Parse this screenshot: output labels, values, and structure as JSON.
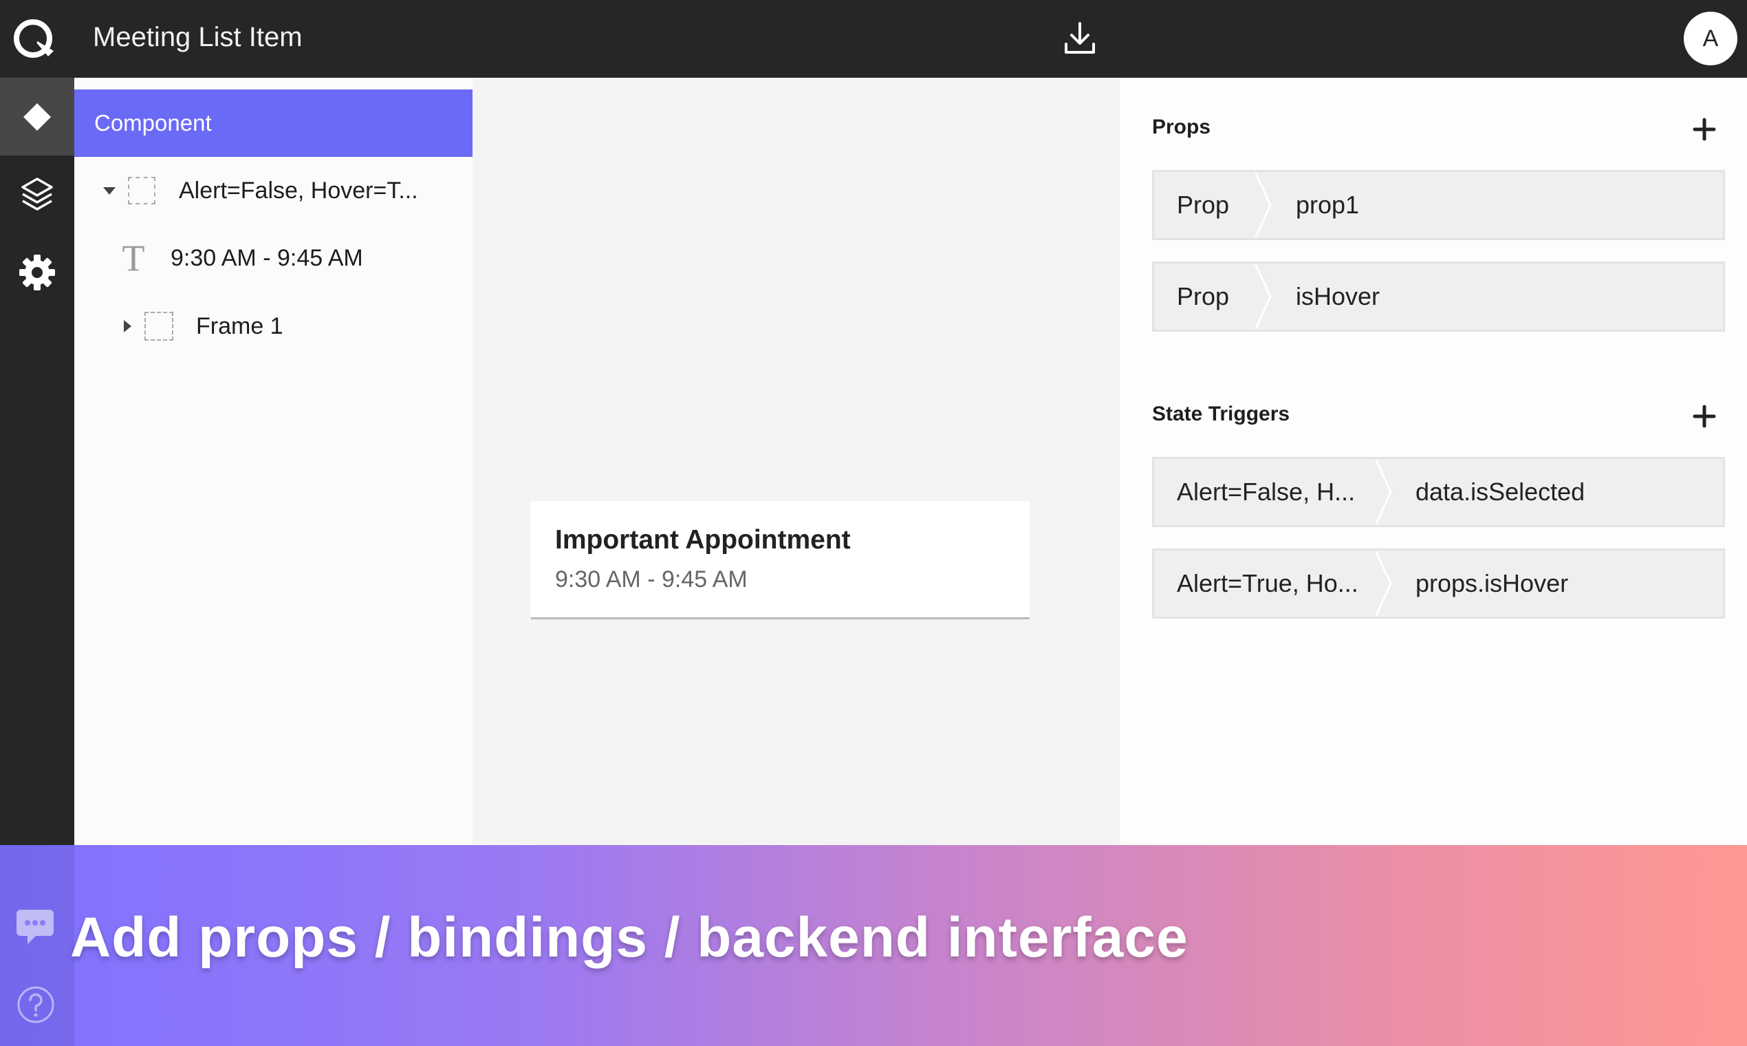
{
  "header": {
    "title": "Meeting List Item",
    "avatar_letter": "A"
  },
  "rail": {
    "icons": [
      "component-diamond-icon",
      "layers-icon",
      "settings-gear-icon"
    ],
    "active": "component-diamond-icon"
  },
  "layers": {
    "header": "Component",
    "items": [
      {
        "label": "Alert=False, Hover=T...",
        "type": "frame",
        "expanded": true
      },
      {
        "label": "9:30 AM - 9:45 AM",
        "type": "text"
      },
      {
        "label": "Frame 1",
        "type": "frame",
        "expanded": false
      }
    ]
  },
  "canvas": {
    "card_title": "Important Appointment",
    "card_time": "9:30 AM - 9:45 AM"
  },
  "props_panel": {
    "props_title": "Props",
    "props": [
      {
        "key": "Prop",
        "value": "prop1"
      },
      {
        "key": "Prop",
        "value": "isHover"
      }
    ],
    "triggers_title": "State Triggers",
    "triggers": [
      {
        "key": "Alert=False, H...",
        "value": "data.isSelected"
      },
      {
        "key": "Alert=True, Ho...",
        "value": "props.isHover"
      }
    ]
  },
  "banner": {
    "text": "Add props / bindings / backend interface"
  },
  "colors": {
    "topbar": "#262626",
    "accent": "#6b6af6",
    "banner_start": "#7f72ff",
    "banner_end": "#ff9893"
  }
}
